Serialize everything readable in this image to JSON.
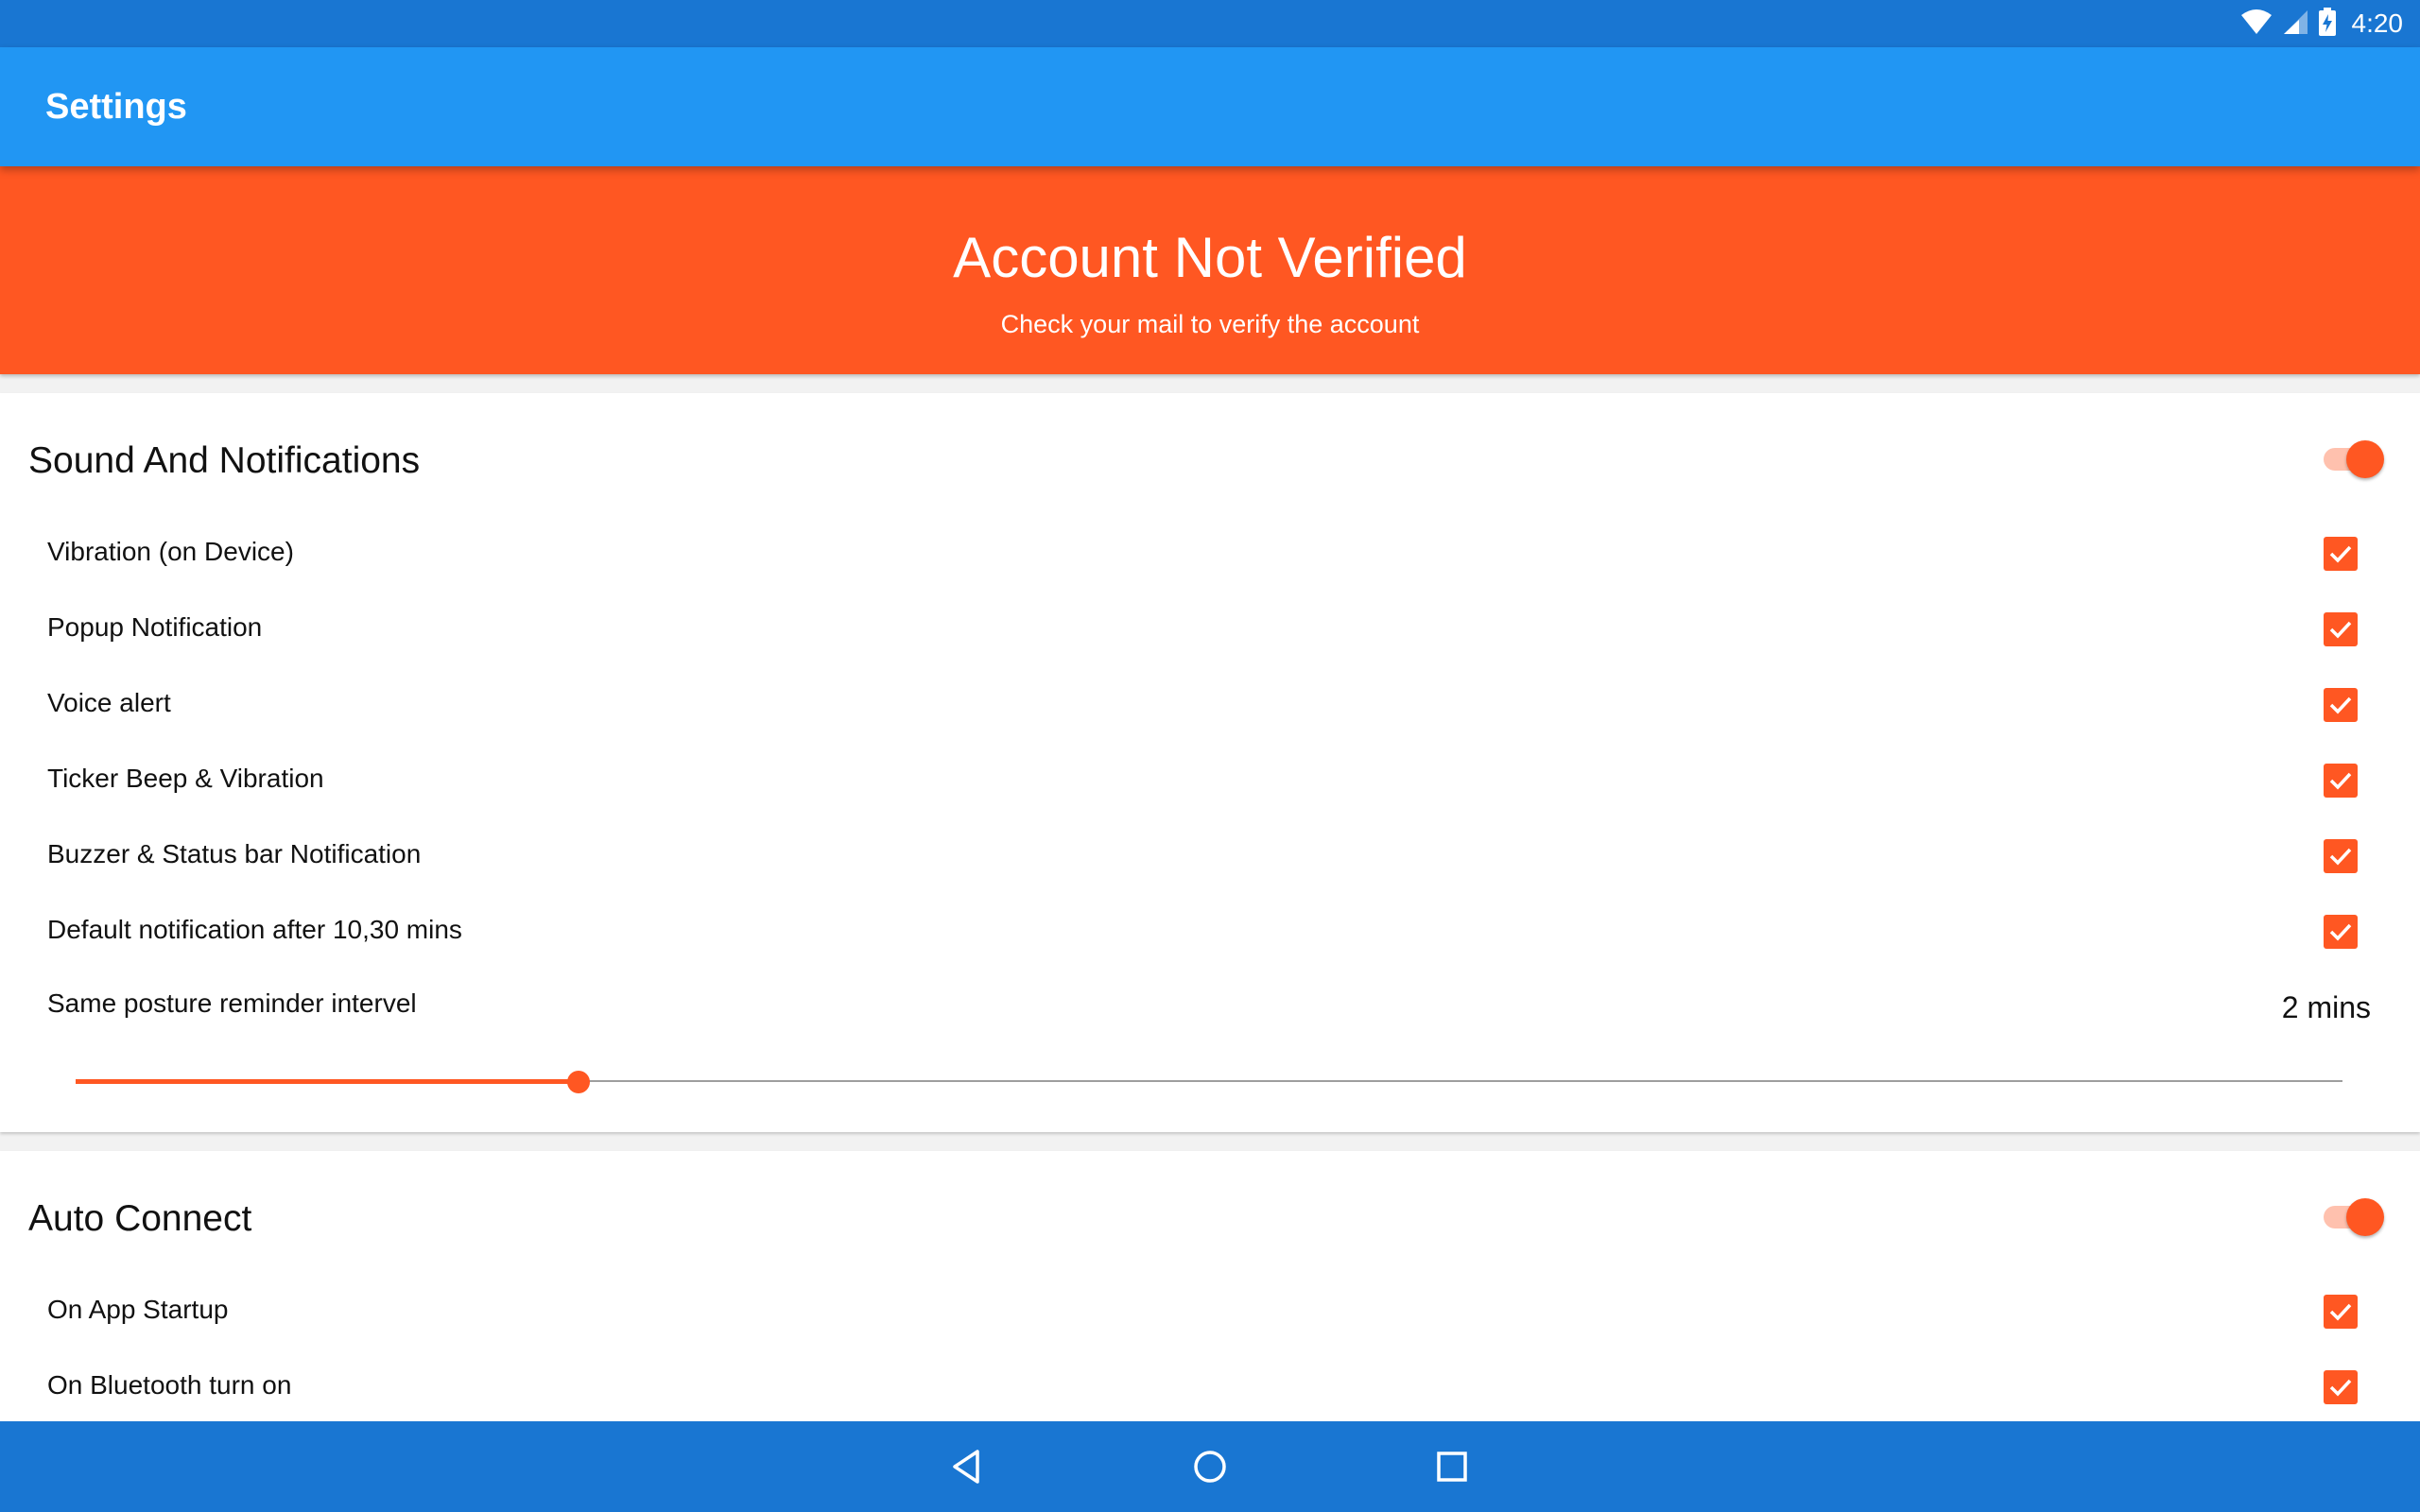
{
  "status_bar": {
    "time": "4:20",
    "icons": [
      "wifi-icon",
      "cell-signal-icon",
      "battery-charging-icon"
    ]
  },
  "app_bar": {
    "title": "Settings"
  },
  "banner": {
    "title": "Account Not Verified",
    "subtitle": "Check your mail to verify the account",
    "color": "#FF5722"
  },
  "sound_section": {
    "title": "Sound And Notifications",
    "enabled": true,
    "items": [
      {
        "label": "Vibration (on Device)",
        "checked": true
      },
      {
        "label": "Popup Notification",
        "checked": true
      },
      {
        "label": "Voice alert",
        "checked": true
      },
      {
        "label": "Ticker Beep & Vibration",
        "checked": true
      },
      {
        "label": "Buzzer & Status bar Notification",
        "checked": true
      },
      {
        "label": "Default notification after 10,30 mins",
        "checked": true
      }
    ],
    "posture": {
      "label": "Same posture reminder intervel",
      "value": "2 mins",
      "slider_fraction": 0.222
    }
  },
  "auto_connect_section": {
    "title": "Auto Connect",
    "enabled": true,
    "items": [
      {
        "label": "On App Startup",
        "checked": true
      },
      {
        "label": "On Bluetooth turn on",
        "checked": true
      }
    ]
  },
  "nav_bar": {
    "buttons": [
      "back-icon",
      "home-icon",
      "recents-icon"
    ]
  },
  "colors": {
    "status_bar": "#1976D2",
    "app_bar": "#2196F3",
    "accent": "#FF5722",
    "toggle_track": "#FFC1AE"
  }
}
